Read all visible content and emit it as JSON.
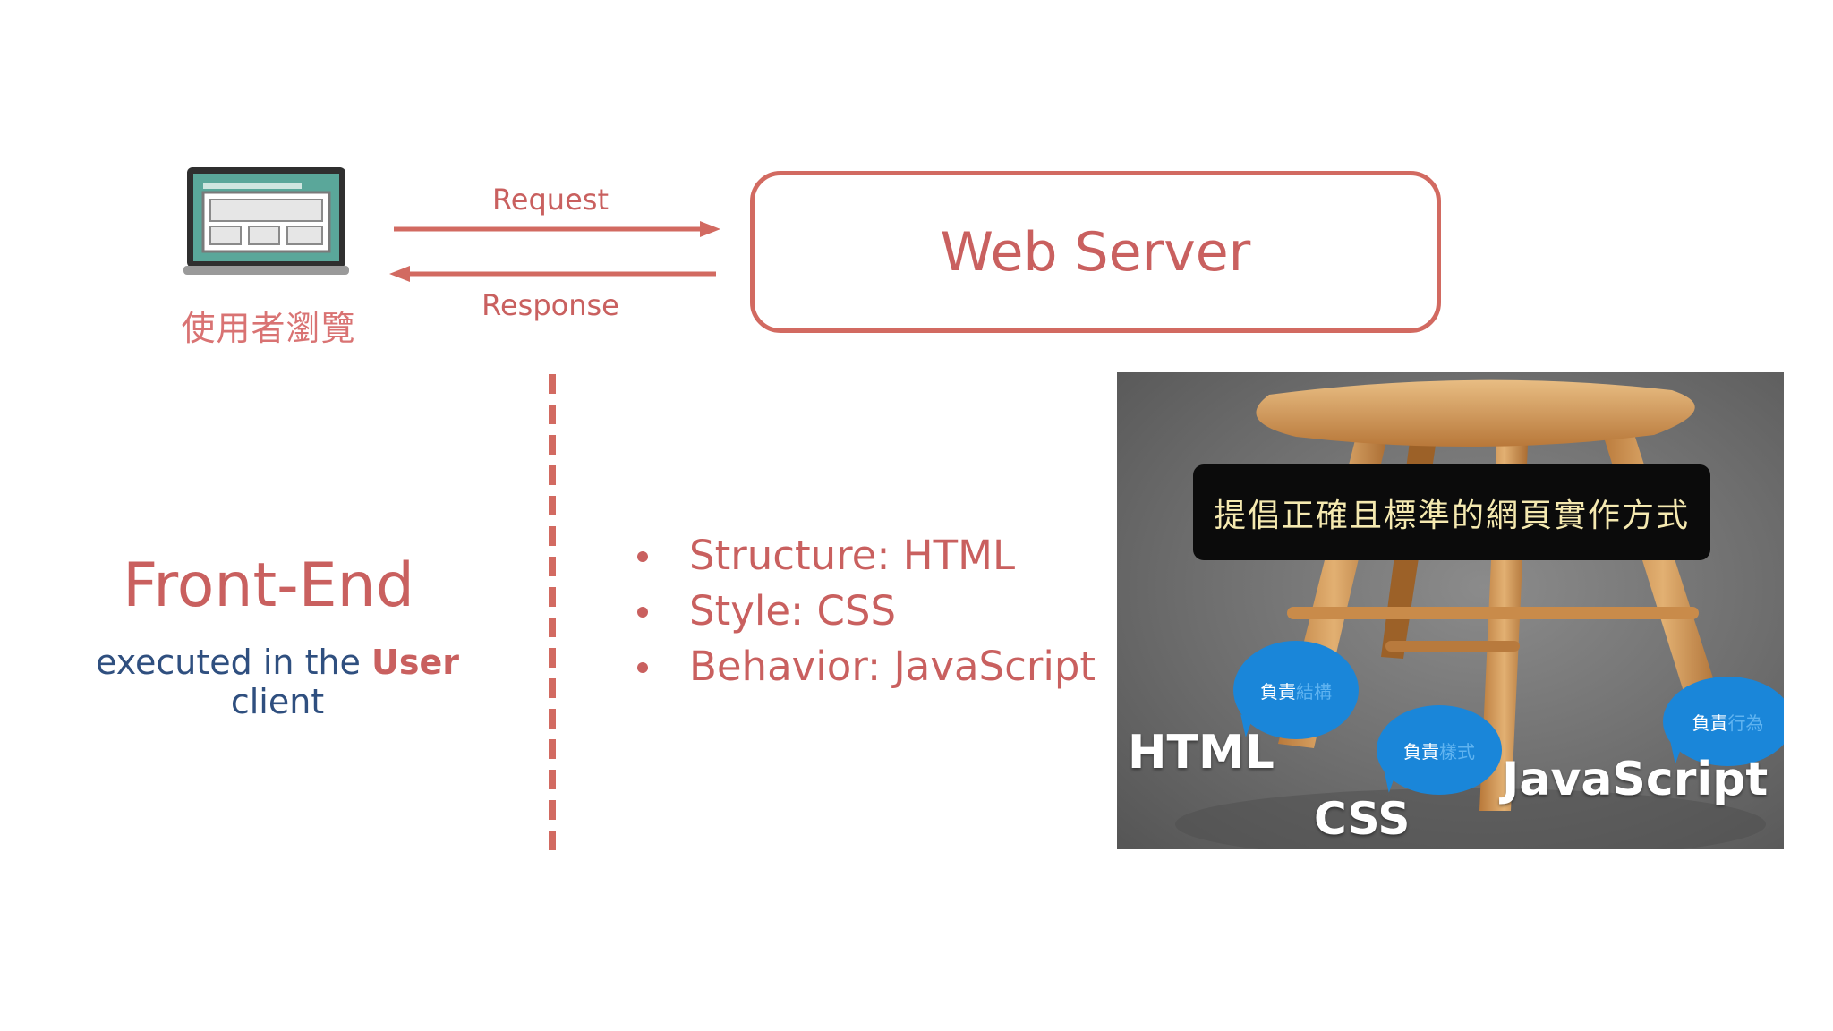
{
  "browser": {
    "icon": "laptop-icon",
    "label": "使用者瀏覽"
  },
  "flow": {
    "request_label": "Request",
    "response_label": "Response"
  },
  "server": {
    "title": "Web Server"
  },
  "frontend": {
    "title": "Front-End",
    "subtitle_prefix": "executed in the ",
    "subtitle_highlight": "User",
    "subtitle_suffix": " client"
  },
  "bullets": [
    "Structure: HTML",
    "Style: CSS",
    "Behavior: JavaScript"
  ],
  "photo": {
    "banner": "提倡正確且標準的網頁實作方式",
    "bubbles": [
      {
        "lead": "負責",
        "rest": "結構"
      },
      {
        "lead": "負責",
        "rest": "樣式"
      },
      {
        "lead": "負責",
        "rest": "行為"
      }
    ],
    "tech_labels": [
      "HTML",
      "CSS",
      "JavaScript"
    ]
  },
  "colors": {
    "accent": "#c9605f",
    "subtitle_blue": "#2f4f7f",
    "bubble_blue": "#1a86d9"
  }
}
